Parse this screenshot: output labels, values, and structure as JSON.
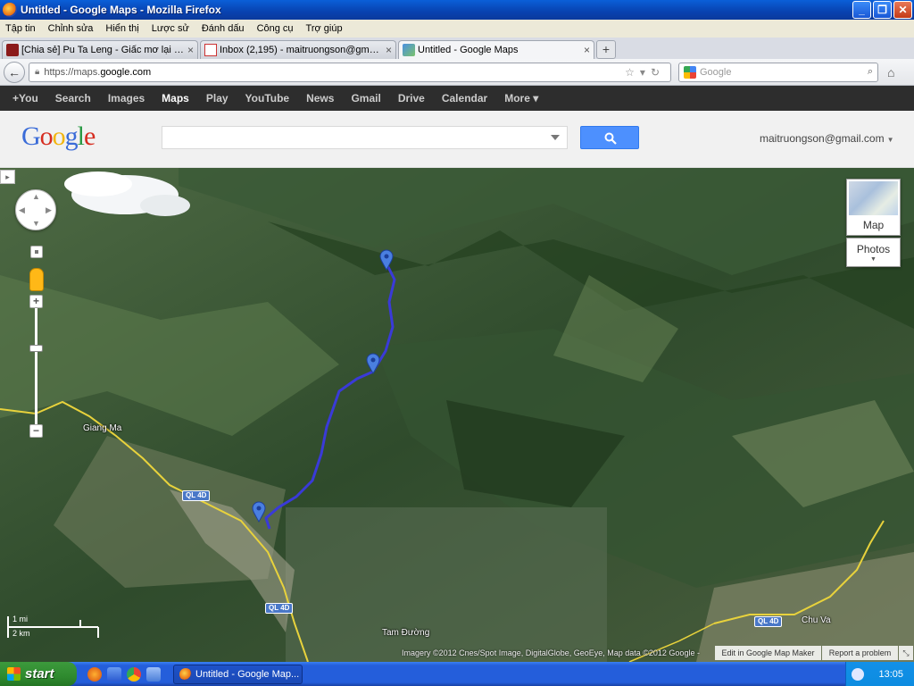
{
  "window": {
    "title": "Untitled - Google Maps - Mozilla Firefox",
    "minimize": "_",
    "maximize": "❐",
    "close": "✕"
  },
  "menu": [
    "Tập tin",
    "Chỉnh sửa",
    "Hiển thị",
    "Lược sử",
    "Đánh dấu",
    "Công cụ",
    "Trợ giúp"
  ],
  "tabs": [
    {
      "label": "[Chia sẻ] Pu Ta Leng - Giấc mơ lại vẫn là ...",
      "close": "×"
    },
    {
      "label": "Inbox (2,195) - maitruongson@gmail.co...",
      "close": "×"
    },
    {
      "label": "Untitled - Google Maps",
      "close": "×"
    }
  ],
  "new_tab": "+",
  "nav": {
    "url_prefix": "https://maps.",
    "url_domain": "google.com",
    "search_placeholder": "Google"
  },
  "gbar": [
    "+You",
    "Search",
    "Images",
    "Maps",
    "Play",
    "YouTube",
    "News",
    "Gmail",
    "Drive",
    "Calendar",
    "More ▾"
  ],
  "maps": {
    "logo": [
      "G",
      "o",
      "o",
      "g",
      "l",
      "e"
    ],
    "search_value": "",
    "account": "maitruongson@gmail.com",
    "map_type": "Map",
    "photos": "Photos",
    "places": {
      "giang_ma": "Giang Ma",
      "tam_duong": "Tam Đường",
      "chu_va": "Chu Va"
    },
    "roads": [
      "QL 4D",
      "QL 4D",
      "QL 4D"
    ],
    "scale": {
      "imperial": "1 mi",
      "metric": "2 km"
    },
    "attribution": "Imagery ©2012 Cnes/Spot Image, DigitalGlobe, GeoEye, Map data ©2012 Google -",
    "map_maker": "Edit in Google Map Maker",
    "report": "Report a problem"
  },
  "taskbar": {
    "start": "start",
    "task": "Untitled - Google Map...",
    "clock": "13:05"
  },
  "colors": {
    "route": "#3a3ad8",
    "marker": "#4a7fe0",
    "road": "#e8d23c",
    "terrain": "#3f5a36"
  }
}
